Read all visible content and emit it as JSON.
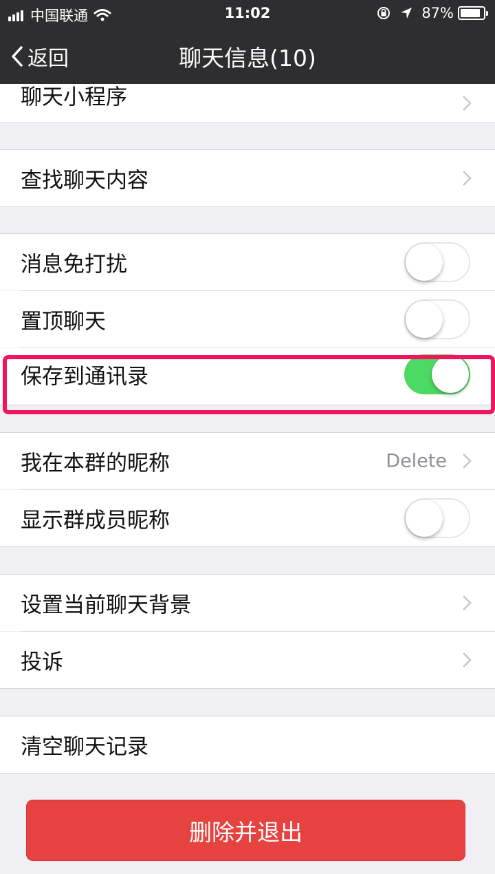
{
  "status_bar": {
    "carrier": "中国联通",
    "time": "11:02",
    "battery": "87%",
    "battery_level": 0.87
  },
  "nav": {
    "back_label": "返回",
    "title": "聊天信息(10)"
  },
  "rows": {
    "mini_program": {
      "label": "聊天小程序"
    },
    "search_chat": {
      "label": "查找聊天内容"
    },
    "mute": {
      "label": "消息免打扰",
      "on": false
    },
    "pin": {
      "label": "置顶聊天",
      "on": false
    },
    "save_contacts": {
      "label": "保存到通讯录",
      "on": true
    },
    "nickname": {
      "label": "我在本群的昵称",
      "value": "Delete"
    },
    "show_nicknames": {
      "label": "显示群成员昵称",
      "on": false
    },
    "background": {
      "label": "设置当前聊天背景"
    },
    "complain": {
      "label": "投诉"
    },
    "clear": {
      "label": "清空聊天记录"
    }
  },
  "actions": {
    "delete_exit": "删除并退出"
  },
  "colors": {
    "toggle_on": "#4cd964",
    "delete_button": "#e64340",
    "highlight_border": "#f0155f",
    "nav_background": "#2e2e30"
  },
  "icons": [
    "signal-icon",
    "wifi-icon",
    "orientation-lock-icon",
    "location-arrow-icon",
    "battery-icon",
    "back-chevron-icon",
    "chevron-right-icon"
  ]
}
